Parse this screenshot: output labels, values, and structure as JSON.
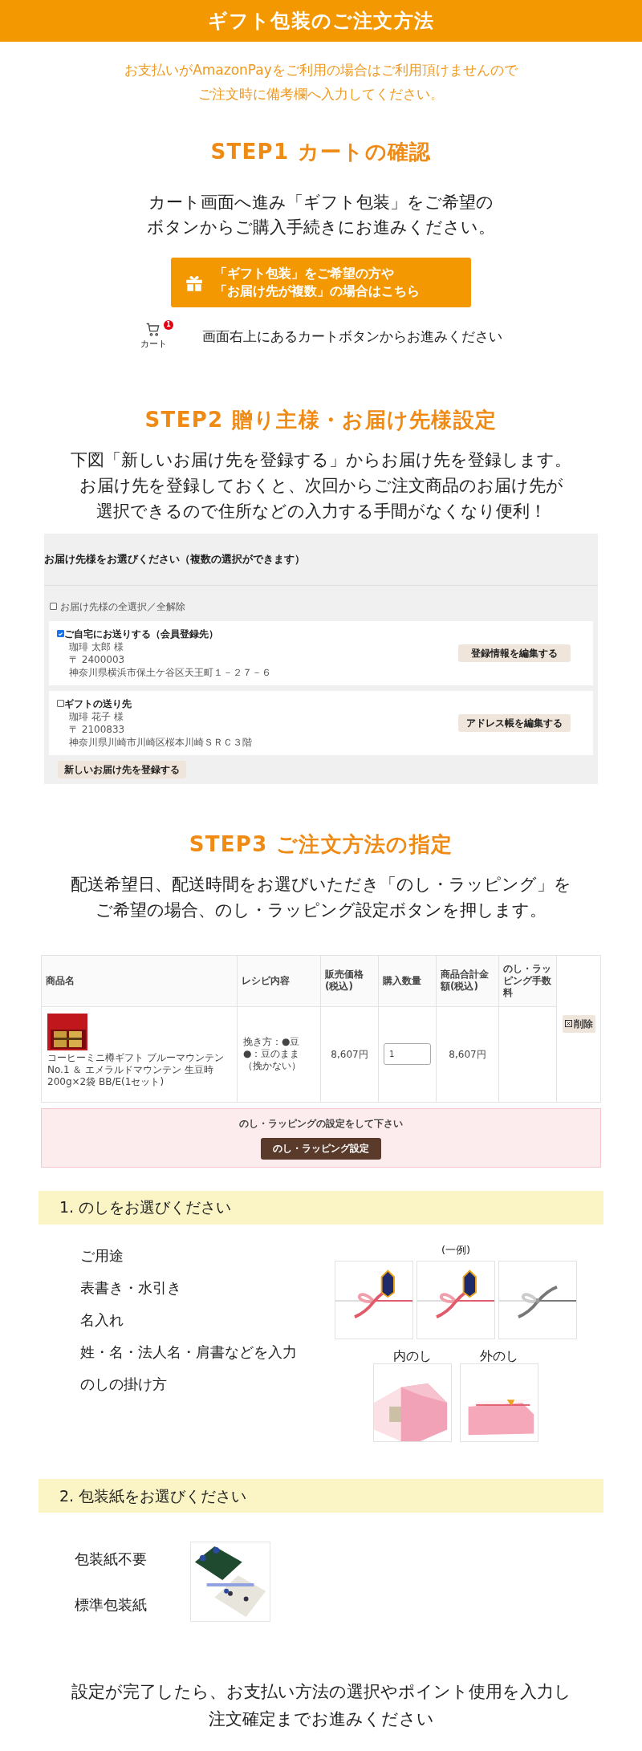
{
  "header": {
    "title": "ギフト包装のご注文方法"
  },
  "notice": [
    "お支払いがAmazonPayをご利用の場合はご利用頂けませんので",
    "ご注文時に備考欄へ入力してください。"
  ],
  "step1": {
    "title": "STEP1 カートの確認",
    "description": [
      "カート画面へ進み「ギフト包装」をご希望の",
      "ボタンからご購入手続きにお進みください。"
    ],
    "gift_button": [
      "「ギフト包装」をご希望の方や",
      "「お届け先が複数」の場合はこちら"
    ],
    "cart_badge": "1",
    "cart_label": "カート",
    "cart_note": "画面右上にあるカートボタンからお進みください"
  },
  "step2": {
    "title": "STEP2 贈り主様・お届け先様設定",
    "description": [
      "下図「新しいお届け先を登録する」からお届け先を登録します。",
      "お届け先を登録しておくと、次回からご注文商品のお届け先が",
      "選択できるので住所などの入力する手間がなくなり便利！"
    ],
    "screen": {
      "heading": "お届け先様をお選びください（複数の選択ができます）",
      "select_all": {
        "label": "お届け先様の全選択／全解除",
        "checked": false
      },
      "addresses": [
        {
          "label": "ご自宅にお送りする（会員登録先）",
          "checked": true,
          "name": "珈琲 太郎 様",
          "postal": "〒 2400003",
          "address": "神奈川県横浜市保土ケ谷区天王町１－２７－６",
          "button": "登録情報を編集する"
        },
        {
          "label": "ギフトの送り先",
          "checked": false,
          "name": "珈琲 花子 様",
          "postal": "〒 2100833",
          "address": "神奈川県川崎市川崎区桜本川崎ＳＲＣ３階",
          "button": "アドレス帳を編集する"
        }
      ],
      "new_button": "新しいお届け先を登録する"
    }
  },
  "step3": {
    "title": "STEP3 ご注文方法の指定",
    "description": [
      "配送希望日、配送時間をお選びいただき「のし・ラッピング」を",
      "ご希望の場合、のし・ラッピング設定ボタンを押します。"
    ],
    "table": {
      "columns": [
        "商品名",
        "レシピ内容",
        "販売価格(税込)",
        "購入数量",
        "商品合計金額(税込)",
        "のし・ラッピング手数料"
      ],
      "row": {
        "product": "コーヒーミニ樽ギフト ブルーマウンテンNo.1 ＆ エメラルドマウンテン 生豆時200g×2袋 BB/E(1セット)",
        "recipe": "挽き方：●豆●：豆のまま（挽かない）",
        "price": "8,607円",
        "quantity": "1",
        "total": "8,607円",
        "delete": "削除"
      }
    },
    "notice": {
      "message": "のし・ラッピングの設定をして下さい",
      "button": "のし・ラッピング設定"
    }
  },
  "noshi": {
    "heading": "1. のしをお選びください",
    "items": [
      "ご用途",
      "表書き・水引き",
      "名入れ",
      "姓・名・法人名・肩書などを入力",
      "のしの掛け方"
    ],
    "example_label": "(一例)",
    "examples": [
      {
        "kind": "picture"
      },
      {
        "kind": "picture"
      },
      {
        "kind": "picture"
      }
    ],
    "placements": [
      "内のし",
      "外のし"
    ]
  },
  "wrapping": {
    "heading": "2. 包装紙をお選びください",
    "options": [
      "包装紙不要",
      "標準包装紙"
    ]
  },
  "footer": [
    "設定が完了したら、お支払い方法の選択やポイント使用を入力し",
    "注文確定までお進みください"
  ]
}
